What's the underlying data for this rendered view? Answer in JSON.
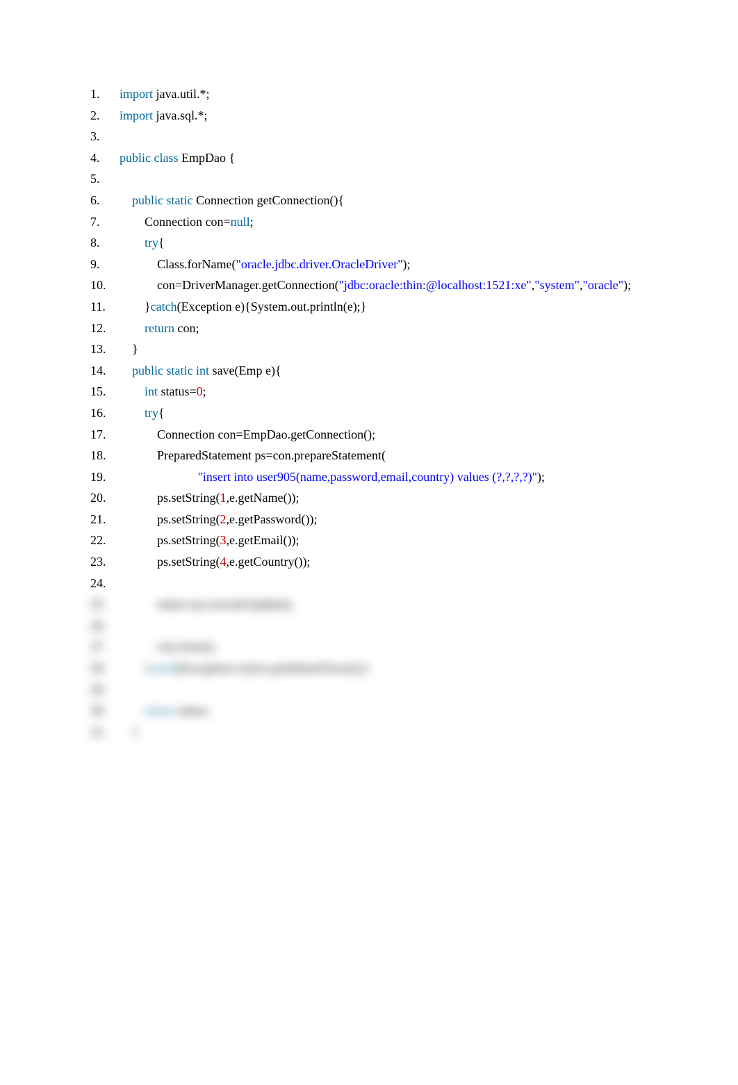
{
  "lines": [
    {
      "tokens": [
        {
          "t": "import",
          "c": "kw"
        },
        {
          "t": " java.util.*;",
          "c": "plain"
        }
      ]
    },
    {
      "tokens": [
        {
          "t": "import",
          "c": "kw"
        },
        {
          "t": " java.sql.*;",
          "c": "plain"
        }
      ]
    },
    {
      "tokens": []
    },
    {
      "tokens": [
        {
          "t": "public",
          "c": "kw"
        },
        {
          "t": " ",
          "c": "plain"
        },
        {
          "t": "class",
          "c": "kw"
        },
        {
          "t": " EmpDao {",
          "c": "plain"
        }
      ]
    },
    {
      "tokens": []
    },
    {
      "tokens": [
        {
          "t": "    ",
          "c": "plain"
        },
        {
          "t": "public",
          "c": "kw"
        },
        {
          "t": " ",
          "c": "plain"
        },
        {
          "t": "static",
          "c": "kw"
        },
        {
          "t": " Connection getConnection(){",
          "c": "plain"
        }
      ]
    },
    {
      "tokens": [
        {
          "t": "        Connection con=",
          "c": "plain"
        },
        {
          "t": "null",
          "c": "kw"
        },
        {
          "t": ";",
          "c": "plain"
        }
      ]
    },
    {
      "tokens": [
        {
          "t": "        ",
          "c": "plain"
        },
        {
          "t": "try",
          "c": "kw"
        },
        {
          "t": "{",
          "c": "plain"
        }
      ]
    },
    {
      "tokens": [
        {
          "t": "            Class.forName(",
          "c": "plain"
        },
        {
          "t": "\"oracle.jdbc.driver.OracleDriver\"",
          "c": "str"
        },
        {
          "t": ");",
          "c": "plain"
        }
      ]
    },
    {
      "tokens": [
        {
          "t": "            con=DriverManager.getConnection(",
          "c": "plain"
        },
        {
          "t": "\"jdbc:oracle:thin:@localhost:1521:xe\"",
          "c": "str"
        },
        {
          "t": ",",
          "c": "plain"
        },
        {
          "t": "\"system\"",
          "c": "str"
        },
        {
          "t": ",",
          "c": "plain"
        },
        {
          "t": "\"oracle\"",
          "c": "str"
        },
        {
          "t": ");",
          "c": "plain"
        }
      ]
    },
    {
      "tokens": [
        {
          "t": "        }",
          "c": "plain"
        },
        {
          "t": "catch",
          "c": "kw"
        },
        {
          "t": "(Exception e){System.out.println(e);}",
          "c": "plain"
        }
      ]
    },
    {
      "tokens": [
        {
          "t": "        ",
          "c": "plain"
        },
        {
          "t": "return",
          "c": "kw"
        },
        {
          "t": " con;",
          "c": "plain"
        }
      ]
    },
    {
      "tokens": [
        {
          "t": "    }",
          "c": "plain"
        }
      ]
    },
    {
      "tokens": [
        {
          "t": "    ",
          "c": "plain"
        },
        {
          "t": "public",
          "c": "kw"
        },
        {
          "t": " ",
          "c": "plain"
        },
        {
          "t": "static",
          "c": "kw"
        },
        {
          "t": " ",
          "c": "plain"
        },
        {
          "t": "int",
          "c": "kw"
        },
        {
          "t": " save(Emp e){",
          "c": "plain"
        }
      ]
    },
    {
      "tokens": [
        {
          "t": "        ",
          "c": "plain"
        },
        {
          "t": "int",
          "c": "kw"
        },
        {
          "t": " status=",
          "c": "plain"
        },
        {
          "t": "0",
          "c": "num"
        },
        {
          "t": ";",
          "c": "plain"
        }
      ]
    },
    {
      "tokens": [
        {
          "t": "        ",
          "c": "plain"
        },
        {
          "t": "try",
          "c": "kw"
        },
        {
          "t": "{",
          "c": "plain"
        }
      ]
    },
    {
      "tokens": [
        {
          "t": "            Connection con=EmpDao.getConnection();",
          "c": "plain"
        }
      ]
    },
    {
      "tokens": [
        {
          "t": "            PreparedStatement ps=con.prepareStatement(",
          "c": "plain"
        }
      ]
    },
    {
      "tokens": [
        {
          "t": "                         ",
          "c": "plain"
        },
        {
          "t": "\"insert into user905(name,password,email,country) values (?,?,?,?)\"",
          "c": "str"
        },
        {
          "t": ");",
          "c": "plain"
        }
      ]
    },
    {
      "tokens": [
        {
          "t": "            ps.setString(",
          "c": "plain"
        },
        {
          "t": "1",
          "c": "num"
        },
        {
          "t": ",e.getName());",
          "c": "plain"
        }
      ]
    },
    {
      "tokens": [
        {
          "t": "            ps.setString(",
          "c": "plain"
        },
        {
          "t": "2",
          "c": "num"
        },
        {
          "t": ",e.getPassword());",
          "c": "plain"
        }
      ]
    },
    {
      "tokens": [
        {
          "t": "            ps.setString(",
          "c": "plain"
        },
        {
          "t": "3",
          "c": "num"
        },
        {
          "t": ",e.getEmail());",
          "c": "plain"
        }
      ]
    },
    {
      "tokens": [
        {
          "t": "            ps.setString(",
          "c": "plain"
        },
        {
          "t": "4",
          "c": "num"
        },
        {
          "t": ",e.getCountry());",
          "c": "plain"
        }
      ]
    },
    {
      "tokens": []
    },
    {
      "blur": true,
      "tokens": [
        {
          "t": "            status=ps.executeUpdate();",
          "c": "plain"
        }
      ]
    },
    {
      "blur": true,
      "tokens": []
    },
    {
      "blur": true,
      "tokens": [
        {
          "t": "            con.close();",
          "c": "plain"
        }
      ]
    },
    {
      "blur": true,
      "tokens": [
        {
          "t": "        }",
          "c": "plain"
        },
        {
          "t": "catch",
          "c": "kw"
        },
        {
          "t": "(Exception ex){ex.printStackTrace();}",
          "c": "plain"
        }
      ]
    },
    {
      "blur": true,
      "tokens": []
    },
    {
      "blur": true,
      "tokens": [
        {
          "t": "        ",
          "c": "plain"
        },
        {
          "t": "return",
          "c": "kw"
        },
        {
          "t": " status;",
          "c": "plain"
        }
      ]
    },
    {
      "blur": true,
      "tokens": [
        {
          "t": "    }",
          "c": "plain"
        }
      ]
    }
  ]
}
